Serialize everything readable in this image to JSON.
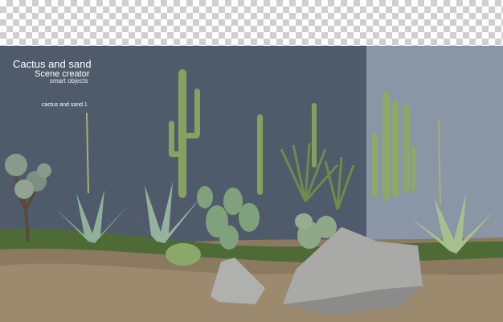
{
  "title": "Cactus and sand",
  "subtitle": "Scene creator",
  "tagline": "smart objects",
  "caption": "cactus and sand 1",
  "colors": {
    "panel_dark": "#4f5b6b",
    "panel_light": "#8a96a6",
    "checker": "#cfcfcf",
    "ground": "#8c7a60",
    "cactus": "#7f9a55",
    "agave": "#8aa88a",
    "rock": "#a8a8a8"
  }
}
